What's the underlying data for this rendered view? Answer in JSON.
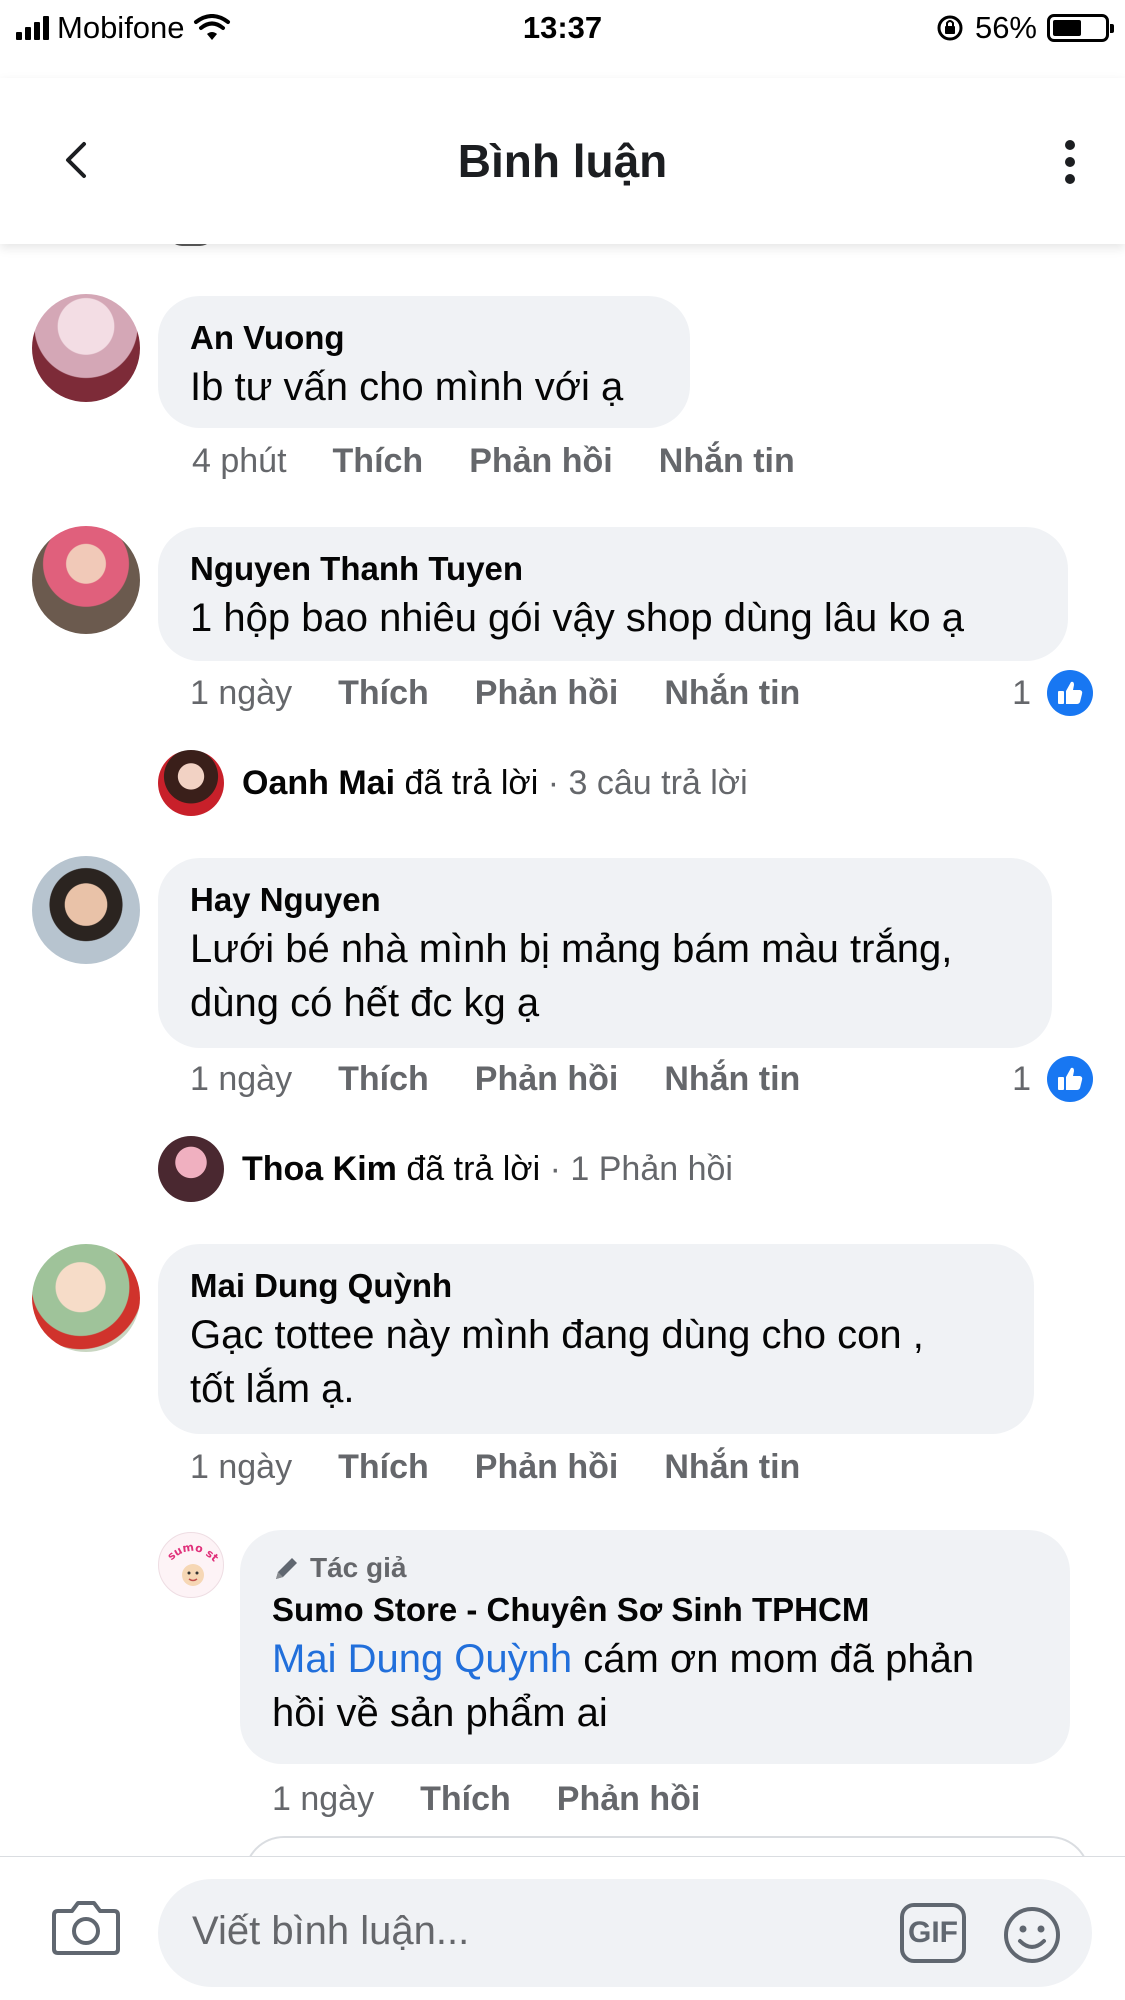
{
  "status_bar": {
    "carrier": "Mobifone",
    "time": "13:37",
    "battery": "56%",
    "battery_level": 0.56
  },
  "header": {
    "title": "Bình luận"
  },
  "comments": [
    {
      "name": "An Vuong",
      "text": "Ib tư vấn cho mình với ạ",
      "time": "4 phút",
      "like": "Thích",
      "reply": "Phản hồi",
      "message": "Nhắn tin"
    },
    {
      "name": "Nguyen Thanh Tuyen",
      "text": "1 hộp bao nhiêu gói vậy shop dùng lâu ko ạ",
      "time": "1 ngày",
      "like": "Thích",
      "reply": "Phản hồi",
      "message": "Nhắn tin",
      "likes": "1",
      "reply_summary": {
        "name": "Oanh Mai",
        "verb": "đã trả lời",
        "count": "· 3 câu trả lời"
      }
    },
    {
      "name": "Hay Nguyen",
      "text_line1": "Lưới bé nhà mình bị mảng bám màu trắng,",
      "text_line2": "dùng có hết đc kg ạ",
      "time": "1 ngày",
      "like": "Thích",
      "reply": "Phản hồi",
      "message": "Nhắn tin",
      "likes": "1",
      "reply_summary": {
        "name": "Thoa Kim",
        "verb": "đã trả lời",
        "count": "· 1 Phản hồi"
      }
    },
    {
      "name": "Mai Dung Quỳnh",
      "text_line1": "Gạc tottee này mình đang dùng cho con ,",
      "text_line2": "tốt lắm ạ.",
      "time": "1 ngày",
      "like": "Thích",
      "reply": "Phản hồi",
      "message": "Nhắn tin"
    }
  ],
  "author_reply": {
    "badge": "Tác giả",
    "name": "Sumo Store - Chuyên Sơ Sinh TPHCM",
    "mention": "Mai Dung Quỳnh",
    "text_line1": "cám ơn mom đã phản",
    "text_line2": "hồi về sản phẩm ai",
    "time": "1 ngày",
    "like": "Thích",
    "reply": "Phản hồi",
    "avatar_text": "sumo store"
  },
  "composer": {
    "placeholder": "Viết bình luận...",
    "gif": "GIF"
  },
  "colors": {
    "bubble": "#f0f2f5",
    "like_blue": "#1877f2",
    "meta_gray": "#65676b",
    "mention_blue": "#216fdb"
  }
}
